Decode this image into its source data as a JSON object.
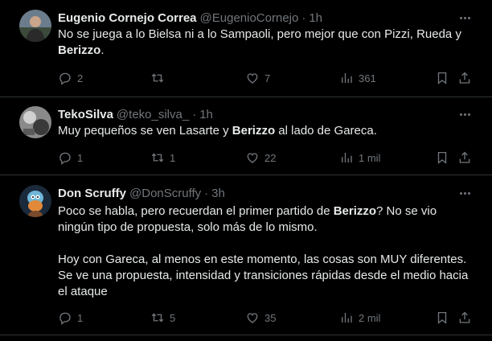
{
  "tweets": [
    {
      "name": "Eugenio Cornejo Correa",
      "handle": "@EugenioCornejo",
      "time": "1h",
      "text_a": "No se juega a lo Bielsa ni a lo Sampaoli, pero mejor que con Pizzi, Rueda y ",
      "text_b": "Berizzo",
      "text_c": ".",
      "replies": "2",
      "retweets": "",
      "likes": "7",
      "views": "361",
      "avatar": "person-photo"
    },
    {
      "name": "TekoSilva",
      "handle": "@teko_silva_",
      "time": "1h",
      "text_a": "Muy pequeños se ven Lasarte y ",
      "text_b": "Berizzo",
      "text_c": " al lado de Gareca.",
      "replies": "1",
      "retweets": "1",
      "likes": "22",
      "views": "1 mil",
      "avatar": "bw-photo"
    },
    {
      "name": "Don Scruffy",
      "handle": "@DonScruffy",
      "time": "3h",
      "text_a": "Poco se habla, pero recuerdan el primer partido de ",
      "text_b": "Berizzo",
      "text_c": "? No se vio ningún tipo de propuesta, solo más de lo mismo.",
      "text_d": "Hoy con Gareca, al menos en este momento, las cosas son MUY diferentes. Se ve una propuesta, intensidad y transiciones rápidas desde el medio hacia el ataque",
      "replies": "1",
      "retweets": "5",
      "likes": "35",
      "views": "2 mil",
      "avatar": "cartoon-avatar"
    }
  ],
  "separator": "·",
  "colors": {
    "background": "#000000",
    "text": "#e7e9ea",
    "muted": "#71767b",
    "border": "#2f3336"
  },
  "icons": [
    "reply-icon",
    "retweet-icon",
    "like-icon",
    "views-icon",
    "bookmark-icon",
    "share-icon",
    "more-icon"
  ]
}
